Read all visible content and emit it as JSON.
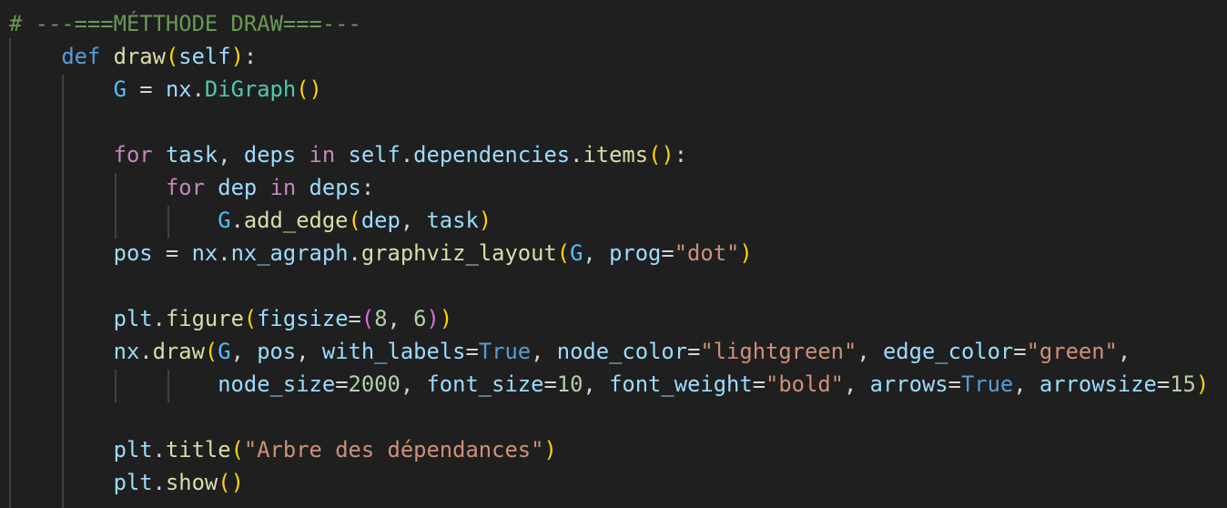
{
  "editor": {
    "background": "#1f1f1f",
    "language": "python",
    "lines": [
      [
        [
          "# ---===MÉTTHODE DRAW===---",
          "comment"
        ]
      ],
      [
        [
          "    ",
          "ws"
        ],
        [
          "def",
          "keyword"
        ],
        [
          " ",
          "ws"
        ],
        [
          "draw",
          "func"
        ],
        [
          "(",
          "b1"
        ],
        [
          "self",
          "var"
        ],
        [
          ")",
          "b1"
        ],
        [
          ":",
          "op"
        ]
      ],
      [
        [
          "        ",
          "ws"
        ],
        [
          "G",
          "const"
        ],
        [
          " = ",
          "op"
        ],
        [
          "nx",
          "var"
        ],
        [
          ".",
          "op"
        ],
        [
          "DiGraph",
          "class"
        ],
        [
          "()",
          "b1"
        ]
      ],
      [],
      [
        [
          "        ",
          "ws"
        ],
        [
          "for",
          "control"
        ],
        [
          " ",
          "ws"
        ],
        [
          "task",
          "var"
        ],
        [
          ", ",
          "op"
        ],
        [
          "deps",
          "var"
        ],
        [
          " ",
          "ws"
        ],
        [
          "in",
          "control"
        ],
        [
          " ",
          "ws"
        ],
        [
          "self",
          "var"
        ],
        [
          ".",
          "op"
        ],
        [
          "dependencies",
          "var"
        ],
        [
          ".",
          "op"
        ],
        [
          "items",
          "func"
        ],
        [
          "()",
          "b1"
        ],
        [
          ":",
          "op"
        ]
      ],
      [
        [
          "            ",
          "ws"
        ],
        [
          "for",
          "control"
        ],
        [
          " ",
          "ws"
        ],
        [
          "dep",
          "var"
        ],
        [
          " ",
          "ws"
        ],
        [
          "in",
          "control"
        ],
        [
          " ",
          "ws"
        ],
        [
          "deps",
          "var"
        ],
        [
          ":",
          "op"
        ]
      ],
      [
        [
          "                ",
          "ws"
        ],
        [
          "G",
          "const"
        ],
        [
          ".",
          "op"
        ],
        [
          "add_edge",
          "func"
        ],
        [
          "(",
          "b1"
        ],
        [
          "dep",
          "var"
        ],
        [
          ", ",
          "op"
        ],
        [
          "task",
          "var"
        ],
        [
          ")",
          "b1"
        ]
      ],
      [
        [
          "        ",
          "ws"
        ],
        [
          "pos",
          "var"
        ],
        [
          " = ",
          "op"
        ],
        [
          "nx",
          "var"
        ],
        [
          ".",
          "op"
        ],
        [
          "nx_agraph",
          "var"
        ],
        [
          ".",
          "op"
        ],
        [
          "graphviz_layout",
          "func"
        ],
        [
          "(",
          "b1"
        ],
        [
          "G",
          "const"
        ],
        [
          ", ",
          "op"
        ],
        [
          "prog",
          "var"
        ],
        [
          "=",
          "op"
        ],
        [
          "\"dot\"",
          "str"
        ],
        [
          ")",
          "b1"
        ]
      ],
      [],
      [
        [
          "        ",
          "ws"
        ],
        [
          "plt",
          "var"
        ],
        [
          ".",
          "op"
        ],
        [
          "figure",
          "func"
        ],
        [
          "(",
          "b1"
        ],
        [
          "figsize",
          "var"
        ],
        [
          "=",
          "op"
        ],
        [
          "(",
          "b2"
        ],
        [
          "8",
          "num"
        ],
        [
          ", ",
          "op"
        ],
        [
          "6",
          "num"
        ],
        [
          ")",
          "b2"
        ],
        [
          ")",
          "b1"
        ]
      ],
      [
        [
          "        ",
          "ws"
        ],
        [
          "nx",
          "var"
        ],
        [
          ".",
          "op"
        ],
        [
          "draw",
          "func"
        ],
        [
          "(",
          "b1"
        ],
        [
          "G",
          "const"
        ],
        [
          ", ",
          "op"
        ],
        [
          "pos",
          "var"
        ],
        [
          ", ",
          "op"
        ],
        [
          "with_labels",
          "var"
        ],
        [
          "=",
          "op"
        ],
        [
          "True",
          "keyword"
        ],
        [
          ", ",
          "op"
        ],
        [
          "node_color",
          "var"
        ],
        [
          "=",
          "op"
        ],
        [
          "\"lightgreen\"",
          "str"
        ],
        [
          ", ",
          "op"
        ],
        [
          "edge_color",
          "var"
        ],
        [
          "=",
          "op"
        ],
        [
          "\"green\"",
          "str"
        ],
        [
          ",",
          "op"
        ]
      ],
      [
        [
          "                ",
          "ws"
        ],
        [
          "node_size",
          "var"
        ],
        [
          "=",
          "op"
        ],
        [
          "2000",
          "num"
        ],
        [
          ", ",
          "op"
        ],
        [
          "font_size",
          "var"
        ],
        [
          "=",
          "op"
        ],
        [
          "10",
          "num"
        ],
        [
          ", ",
          "op"
        ],
        [
          "font_weight",
          "var"
        ],
        [
          "=",
          "op"
        ],
        [
          "\"bold\"",
          "str"
        ],
        [
          ", ",
          "op"
        ],
        [
          "arrows",
          "var"
        ],
        [
          "=",
          "op"
        ],
        [
          "True",
          "keyword"
        ],
        [
          ", ",
          "op"
        ],
        [
          "arrowsize",
          "var"
        ],
        [
          "=",
          "op"
        ],
        [
          "15",
          "num"
        ],
        [
          ")",
          "b1"
        ]
      ],
      [],
      [
        [
          "        ",
          "ws"
        ],
        [
          "plt",
          "var"
        ],
        [
          ".",
          "op"
        ],
        [
          "title",
          "func"
        ],
        [
          "(",
          "b1"
        ],
        [
          "\"Arbre des dépendances\"",
          "str"
        ],
        [
          ")",
          "b1"
        ]
      ],
      [
        [
          "        ",
          "ws"
        ],
        [
          "plt",
          "var"
        ],
        [
          ".",
          "op"
        ],
        [
          "show",
          "func"
        ],
        [
          "()",
          "b1"
        ]
      ]
    ]
  }
}
